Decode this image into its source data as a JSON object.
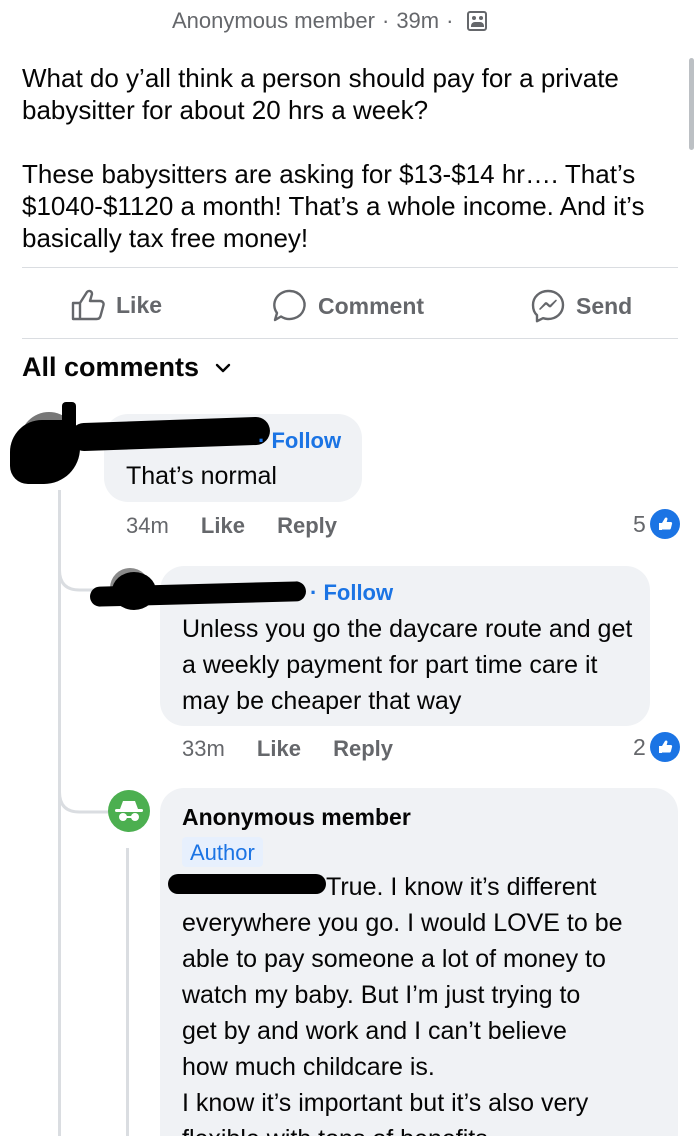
{
  "post": {
    "author": "Anonymous member",
    "time": "39m",
    "question": "What do y’all think a person should pay for a private babysitter for about 20 hrs a week?",
    "body": "These babysitters are asking for $13-$14 hr…. That’s $1040-$1120 a month! That’s a whole income. And it’s basically tax free money!"
  },
  "actions": {
    "like": "Like",
    "comment": "Comment",
    "send": "Send"
  },
  "comments_header": "All comments",
  "comments": [
    {
      "follow": "Follow",
      "text": "That’s normal",
      "time": "34m",
      "like": "Like",
      "reply": "Reply",
      "reactions": "5"
    },
    {
      "follow": "Follow",
      "text": "Unless you go the daycare route and get a weekly payment for part time care it may be cheaper that way",
      "time": "33m",
      "like": "Like",
      "reply": "Reply",
      "reactions": "2"
    }
  ],
  "author_reply": {
    "name": "Anonymous member",
    "badge": "Author",
    "lines": [
      "True. I know it’s different",
      "everywhere you go. I would LOVE to be",
      "able to pay someone a lot of money to",
      "watch my baby. But I’m just trying to",
      "get by and work and I can’t believe",
      "how much childcare is.",
      "I know it’s important but it’s also very",
      "flexible with tons of benefits"
    ]
  },
  "icons": {
    "like": "thumbs-up-icon",
    "comment": "speech-bubble-icon",
    "send": "messenger-icon",
    "group": "group-icon",
    "anonymous": "incognito-icon"
  },
  "colors": {
    "accent": "#1b74e4",
    "muted": "#65676b",
    "bubble": "#f0f2f5",
    "anonymous": "#4caf50"
  }
}
